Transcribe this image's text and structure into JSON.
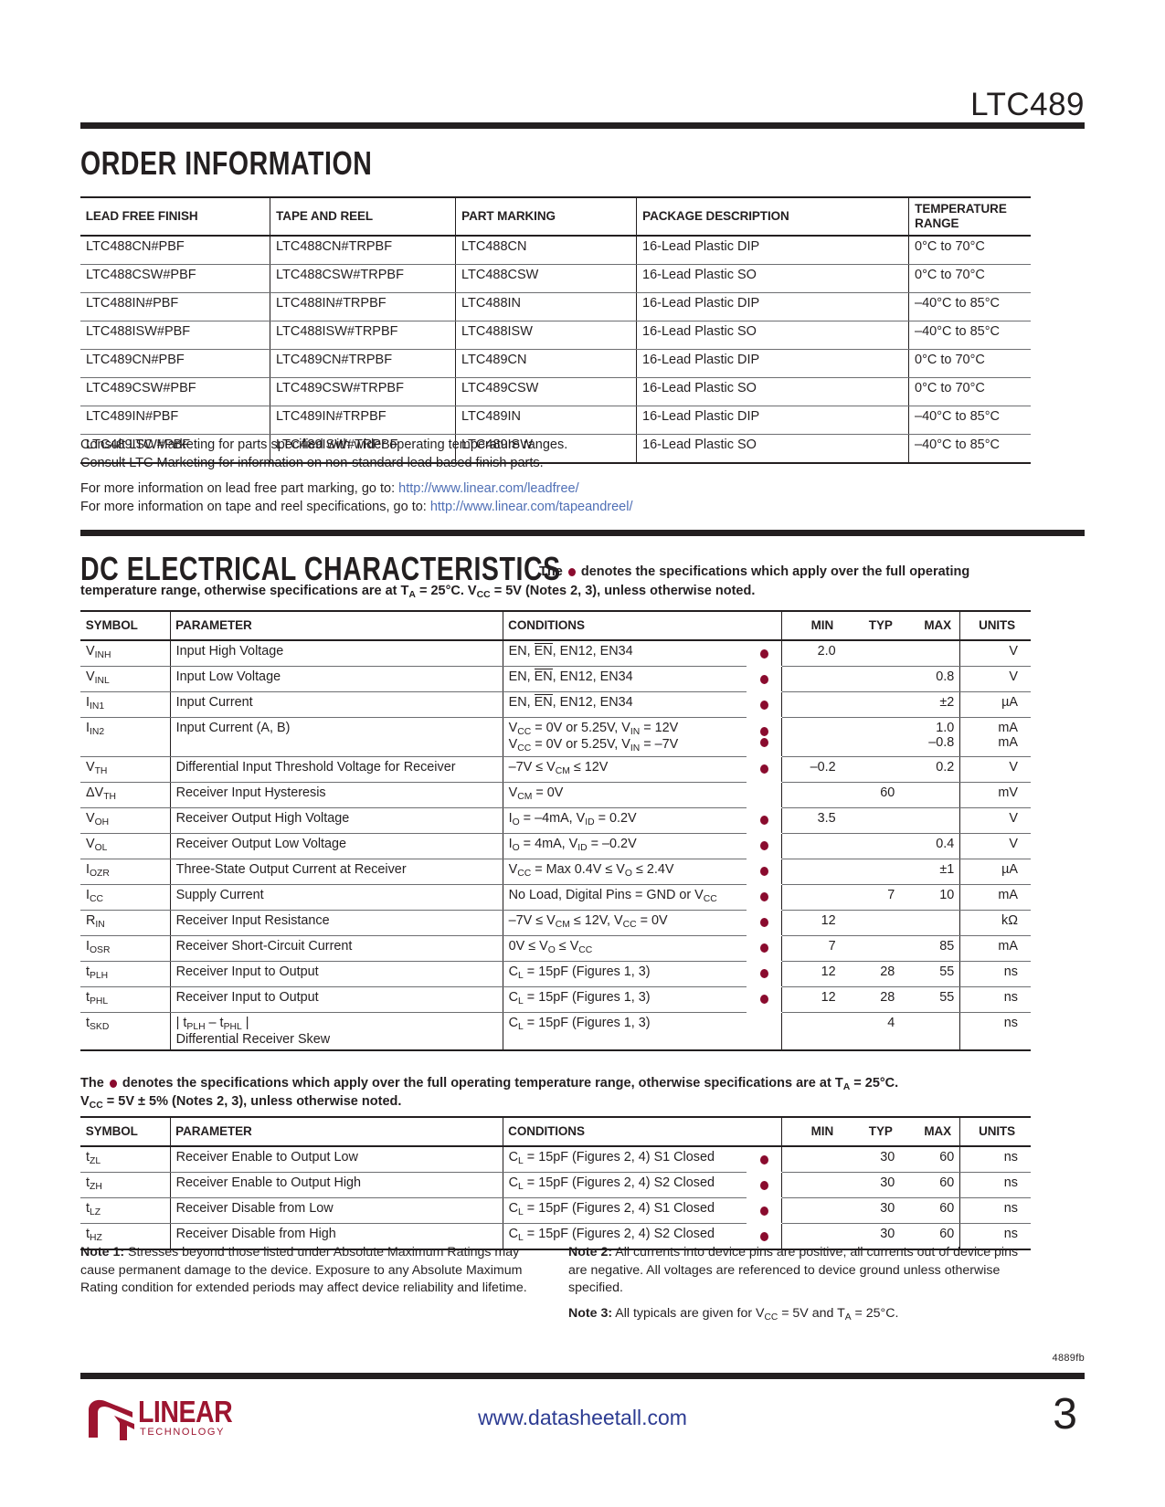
{
  "header": {
    "part_number": "LTC489"
  },
  "order_section": {
    "heading": "ORDER INFORMATION",
    "columns": [
      "LEAD FREE FINISH",
      "TAPE AND REEL",
      "PART MARKING",
      "PACKAGE DESCRIPTION",
      "TEMPERATURE RANGE"
    ],
    "rows": [
      [
        "LTC488CN#PBF",
        "LTC488CN#TRPBF",
        "LTC488CN",
        "16-Lead Plastic DIP",
        "0°C to 70°C"
      ],
      [
        "LTC488CSW#PBF",
        "LTC488CSW#TRPBF",
        "LTC488CSW",
        "16-Lead Plastic SO",
        "0°C to 70°C"
      ],
      [
        "LTC488IN#PBF",
        "LTC488IN#TRPBF",
        "LTC488IN",
        "16-Lead Plastic DIP",
        "–40°C to 85°C"
      ],
      [
        "LTC488ISW#PBF",
        "LTC488ISW#TRPBF",
        "LTC488ISW",
        "16-Lead Plastic SO",
        "–40°C to 85°C"
      ],
      [
        "LTC489CN#PBF",
        "LTC489CN#TRPBF",
        "LTC489CN",
        "16-Lead Plastic DIP",
        "0°C to 70°C"
      ],
      [
        "LTC489CSW#PBF",
        "LTC489CSW#TRPBF",
        "LTC489CSW",
        "16-Lead Plastic SO",
        "0°C to 70°C"
      ],
      [
        "LTC489IN#PBF",
        "LTC489IN#TRPBF",
        "LTC489IN",
        "16-Lead Plastic DIP",
        "–40°C to 85°C"
      ],
      [
        "LTC489ISW#PBF",
        "LTC489ISW#TRPBF",
        "LTC489ISW",
        "16-Lead Plastic SO",
        "–40°C to 85°C"
      ]
    ],
    "consult_line_1": "Consult LTC Marketing for parts specified with wider operating temperature ranges.",
    "consult_line_2": "Consult LTC Marketing for information on non-standard lead based finish parts.",
    "leadfree_prefix": "For more information on lead free part marking, go to: ",
    "leadfree_url": "http://www.linear.com/leadfree/",
    "tapereel_prefix": "For more information on tape and reel specifications, go to: ",
    "tapereel_url": "http://www.linear.com/tapeandreel/"
  },
  "dc_section": {
    "heading": "DC ELECTRICAL CHARACTERISTICS",
    "subhead_part1": "The ",
    "subhead_part2": " denotes the specifications which apply over the full operating",
    "subhead_line2_a": "temperature range, otherwise specifications are at T",
    "subhead_line2_b": "A",
    "subhead_line2_c": " = 25°C. V",
    "subhead_line2_d": "CC",
    "subhead_line2_e": " = 5V (Notes 2, 3), unless otherwise noted.",
    "columns": [
      "SYMBOL",
      "PARAMETER",
      "CONDITIONS",
      "MIN",
      "TYP",
      "MAX",
      "UNITS"
    ],
    "rows": [
      {
        "symbol": "V",
        "sub": "INH",
        "parameter": "Input High Voltage",
        "conditions": "EN, EN, EN12, EN34",
        "cond_overline": "EN",
        "bullets": 1,
        "min": "2.0",
        "typ": "",
        "max": "",
        "units": "V"
      },
      {
        "symbol": "V",
        "sub": "INL",
        "parameter": "Input Low Voltage",
        "conditions": "EN, EN, EN12, EN34",
        "cond_overline": "EN",
        "bullets": 1,
        "min": "",
        "typ": "",
        "max": "0.8",
        "units": "V"
      },
      {
        "symbol": "I",
        "sub": "IN1",
        "parameter": "Input Current",
        "conditions": "EN, EN, EN12, EN34",
        "cond_overline": "EN",
        "bullets": 1,
        "min": "",
        "typ": "",
        "max": "±2",
        "units": "µA"
      },
      {
        "symbol": "I",
        "sub": "IN2",
        "parameter": "Input Current (A, B)",
        "conditions": "",
        "bullets": 2,
        "min": "",
        "typ": "",
        "max": "1.0\n–0.8",
        "units": "mA\nmA",
        "cond_lines": [
          {
            "a": "V",
            "asub": "CC",
            "b": " = 0V or 5.25V, V",
            "bsub": "IN",
            "c": " = 12V"
          },
          {
            "a": "V",
            "asub": "CC",
            "b": " = 0V or 5.25V, V",
            "bsub": "IN",
            "c": " = –7V"
          }
        ],
        "max_lines": [
          "1.0",
          "–0.8"
        ],
        "unit_lines": [
          "mA",
          "mA"
        ]
      },
      {
        "symbol": "V",
        "sub": "TH",
        "parameter": "Differential Input Threshold Voltage for Receiver",
        "bullets": 1,
        "min": "–0.2",
        "typ": "",
        "max": "0.2",
        "units": "V",
        "cond_lines": [
          {
            "a": "–7V ≤ V",
            "asub": "CM",
            "b": " ≤ 12V",
            "bsub": "",
            "c": ""
          }
        ]
      },
      {
        "symbol": "ΔV",
        "sub": "TH",
        "parameter": "Receiver Input Hysteresis",
        "bullets": 0,
        "min": "",
        "typ": "60",
        "max": "",
        "units": "mV",
        "cond_lines": [
          {
            "a": "V",
            "asub": "CM",
            "b": " = 0V",
            "bsub": "",
            "c": ""
          }
        ]
      },
      {
        "symbol": "V",
        "sub": "OH",
        "parameter": "Receiver Output High Voltage",
        "bullets": 1,
        "min": "3.5",
        "typ": "",
        "max": "",
        "units": "V",
        "cond_lines": [
          {
            "a": "I",
            "asub": "O",
            "b": " = –4mA, V",
            "bsub": "ID",
            "c": " = 0.2V"
          }
        ]
      },
      {
        "symbol": "V",
        "sub": "OL",
        "parameter": "Receiver Output Low Voltage",
        "bullets": 1,
        "min": "",
        "typ": "",
        "max": "0.4",
        "units": "V",
        "cond_lines": [
          {
            "a": "I",
            "asub": "O",
            "b": " = 4mA, V",
            "bsub": "ID",
            "c": " = –0.2V"
          }
        ]
      },
      {
        "symbol": "I",
        "sub": "OZR",
        "parameter": "Three-State Output Current at Receiver",
        "bullets": 1,
        "min": "",
        "typ": "",
        "max": "±1",
        "units": "µA",
        "cond_lines": [
          {
            "a": "V",
            "asub": "CC",
            "b": " = Max 0.4V ≤ V",
            "bsub": "O",
            "c": " ≤ 2.4V"
          }
        ]
      },
      {
        "symbol": "I",
        "sub": "CC",
        "parameter": "Supply Current",
        "bullets": 1,
        "min": "",
        "typ": "7",
        "max": "10",
        "units": "mA",
        "cond_lines": [
          {
            "a": "No Load, Digital Pins = GND or V",
            "asub": "CC",
            "b": "",
            "bsub": "",
            "c": ""
          }
        ]
      },
      {
        "symbol": "R",
        "sub": "IN",
        "parameter": "Receiver Input Resistance",
        "bullets": 1,
        "min": "12",
        "typ": "",
        "max": "",
        "units": "kΩ",
        "cond_lines": [
          {
            "a": "–7V ≤ V",
            "asub": "CM",
            "b": " ≤ 12V, V",
            "bsub": "CC",
            "c": " = 0V"
          }
        ]
      },
      {
        "symbol": "I",
        "sub": "OSR",
        "parameter": "Receiver Short-Circuit Current",
        "bullets": 1,
        "min": "7",
        "typ": "",
        "max": "85",
        "units": "mA",
        "cond_lines": [
          {
            "a": "0V ≤ V",
            "asub": "O",
            "b": " ≤ V",
            "bsub": "CC",
            "c": ""
          }
        ]
      },
      {
        "symbol": "t",
        "sub": "PLH",
        "parameter": "Receiver Input to Output",
        "bullets": 1,
        "min": "12",
        "typ": "28",
        "max": "55",
        "units": "ns",
        "cond_lines": [
          {
            "a": "C",
            "asub": "L",
            "b": " = 15pF (Figures 1, 3)",
            "bsub": "",
            "c": ""
          }
        ]
      },
      {
        "symbol": "t",
        "sub": "PHL",
        "parameter": "Receiver Input to Output",
        "bullets": 1,
        "min": "12",
        "typ": "28",
        "max": "55",
        "units": "ns",
        "cond_lines": [
          {
            "a": "C",
            "asub": "L",
            "b": " = 15pF (Figures 1, 3)",
            "bsub": "",
            "c": ""
          }
        ]
      },
      {
        "symbol": "t",
        "sub": "SKD",
        "parameter": "",
        "param_special": true,
        "param_line1_a": "| t",
        "param_line1_asub": "PLH",
        "param_line1_b": " – t",
        "param_line1_bsub": "PHL",
        "param_line1_c": " |",
        "param_line2": "Differential Receiver Skew",
        "bullets": 0,
        "min": "",
        "typ": "4",
        "max": "",
        "units": "ns",
        "cond_lines": [
          {
            "a": "C",
            "asub": "L",
            "b": " = 15pF (Figures 1, 3)",
            "bsub": "",
            "c": ""
          }
        ]
      }
    ]
  },
  "ac_section": {
    "subhead_a": "The ",
    "subhead_b": " denotes the specifications which apply over the full operating temperature range, otherwise specifications are at T",
    "subhead_b_sub": "A",
    "subhead_c": " = 25°C.",
    "subhead_line2_a": "V",
    "subhead_line2_asub": "CC",
    "subhead_line2_b": " = 5V ± 5% (Notes 2, 3), unless otherwise noted.",
    "columns": [
      "SYMBOL",
      "PARAMETER",
      "CONDITIONS",
      "MIN",
      "TYP",
      "MAX",
      "UNITS"
    ],
    "rows": [
      {
        "symbol": "t",
        "sub": "ZL",
        "parameter": "Receiver Enable to Output Low",
        "cond_a": "C",
        "cond_asub": "L",
        "cond_b": " = 15pF (Figures 2, 4) S1 Closed",
        "bullets": 1,
        "min": "",
        "typ": "30",
        "max": "60",
        "units": "ns"
      },
      {
        "symbol": "t",
        "sub": "ZH",
        "parameter": "Receiver Enable to Output High",
        "cond_a": "C",
        "cond_asub": "L",
        "cond_b": " = 15pF (Figures 2, 4) S2 Closed",
        "bullets": 1,
        "min": "",
        "typ": "30",
        "max": "60",
        "units": "ns"
      },
      {
        "symbol": "t",
        "sub": "LZ",
        "parameter": "Receiver Disable from Low",
        "cond_a": "C",
        "cond_asub": "L",
        "cond_b": " = 15pF (Figures 2, 4) S1 Closed",
        "bullets": 1,
        "min": "",
        "typ": "30",
        "max": "60",
        "units": "ns"
      },
      {
        "symbol": "t",
        "sub": "HZ",
        "parameter": "Receiver Disable from High",
        "cond_a": "C",
        "cond_asub": "L",
        "cond_b": " = 15pF (Figures 2, 4) S2 Closed",
        "bullets": 1,
        "min": "",
        "typ": "30",
        "max": "60",
        "units": "ns"
      }
    ]
  },
  "notes": {
    "note1_label": "Note 1:",
    "note1_text": " Stresses beyond those listed under Absolute Maximum Ratings may cause permanent damage to the device. Exposure to any Absolute Maximum Rating condition for extended periods may affect device reliability and lifetime.",
    "note2_label": "Note 2:",
    "note2_text": " All currents into device pins are positive; all currents out of device pins are negative. All voltages are referenced to device ground unless otherwise specified.",
    "note3_label": "Note 3:",
    "note3_text_a": " All typicals are given for V",
    "note3_sub1": "CC",
    "note3_text_b": " = 5V and T",
    "note3_sub2": "A",
    "note3_text_c": " = 25°C."
  },
  "footer": {
    "doc_code": "4889fb",
    "url": "www.datasheetall.com",
    "page_number": "3",
    "logo_word": "LINEAR",
    "logo_sub": "TECHNOLOGY"
  },
  "colors": {
    "bullet_red": "#8a0b2e",
    "link_blue": "#4f6fb5",
    "url_blue": "#2c3b92",
    "logo_red": "#9d1530",
    "ink": "#231f20"
  }
}
